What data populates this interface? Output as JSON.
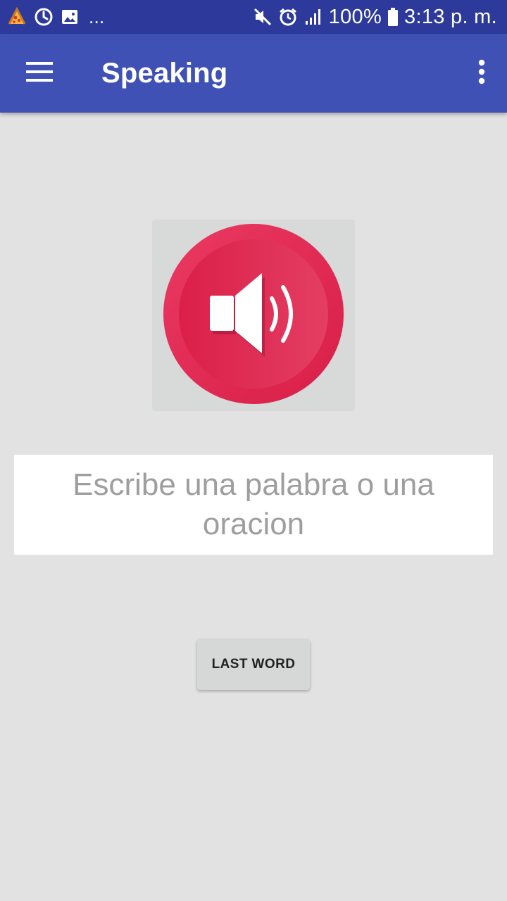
{
  "status_bar": {
    "notification_icons": [
      "pizza-icon",
      "sync-icon",
      "image-icon"
    ],
    "more_indicator": "...",
    "system_icons": [
      "mute-icon",
      "alarm-icon",
      "signal-icon",
      "battery-icon"
    ],
    "battery": "100%",
    "time": "3:13 p. m."
  },
  "app_bar": {
    "title": "Speaking",
    "menu_icon": "hamburger-menu-icon",
    "overflow_icon": "more-vert-icon"
  },
  "main": {
    "speaker_icon": "speaker-volume-icon",
    "accent_color": "#e0234f",
    "input": {
      "placeholder": "Escribe una palabra o una oracion",
      "value": ""
    },
    "last_word_button": "LAST WORD"
  },
  "colors": {
    "status_bar": "#2d3a9b",
    "app_bar": "#3f51b5",
    "background": "#e2e2e2"
  }
}
